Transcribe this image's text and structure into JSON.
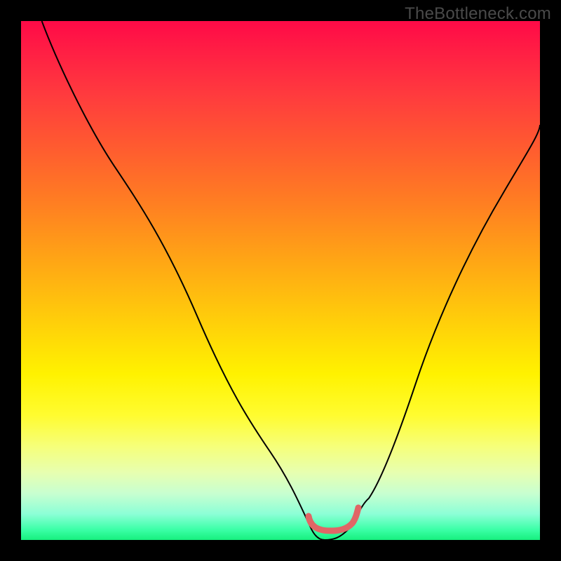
{
  "watermark": "TheBottleneck.com",
  "chart_data": {
    "type": "line",
    "title": "",
    "xlabel": "",
    "ylabel": "",
    "xlim": [
      0,
      100
    ],
    "ylim": [
      0,
      100
    ],
    "series": [
      {
        "name": "bottleneck-curve",
        "x": [
          4,
          10,
          18,
          26,
          34,
          42,
          48,
          52,
          55,
          57,
          58.5,
          60,
          62,
          65,
          67,
          69,
          72,
          76,
          81,
          87,
          93,
          100
        ],
        "y": [
          100,
          87,
          72,
          57,
          43,
          29,
          17,
          9,
          4,
          2,
          1.3,
          1.3,
          2,
          4,
          8,
          13,
          20,
          30,
          42,
          55,
          67,
          80
        ]
      },
      {
        "name": "optimal-zone-marker",
        "x": [
          55.4,
          55.6,
          56.0,
          56.6,
          57.4,
          58.4,
          59.6,
          60.8,
          62.0,
          63.0,
          63.8,
          64.4,
          64.8,
          65.0
        ],
        "y": [
          4.6,
          3.8,
          3.1,
          2.5,
          2.1,
          1.8,
          1.7,
          1.8,
          2.1,
          2.6,
          3.3,
          4.1,
          5.1,
          6.2
        ]
      }
    ],
    "gradient_stops": [
      {
        "pos": 0,
        "color": "#ff0a47"
      },
      {
        "pos": 6,
        "color": "#ff1f44"
      },
      {
        "pos": 14,
        "color": "#ff3a3e"
      },
      {
        "pos": 24,
        "color": "#ff5a30"
      },
      {
        "pos": 35,
        "color": "#ff7e22"
      },
      {
        "pos": 46,
        "color": "#ffa515"
      },
      {
        "pos": 58,
        "color": "#ffcf0a"
      },
      {
        "pos": 68,
        "color": "#fff200"
      },
      {
        "pos": 76,
        "color": "#fffc30"
      },
      {
        "pos": 82,
        "color": "#f6ff7a"
      },
      {
        "pos": 87,
        "color": "#e7ffb0"
      },
      {
        "pos": 91,
        "color": "#c8ffd0"
      },
      {
        "pos": 95,
        "color": "#8cffd6"
      },
      {
        "pos": 98,
        "color": "#3bffa7"
      },
      {
        "pos": 100,
        "color": "#17f07e"
      }
    ],
    "marker_color": "#e06666",
    "curve_color": "#000000"
  }
}
